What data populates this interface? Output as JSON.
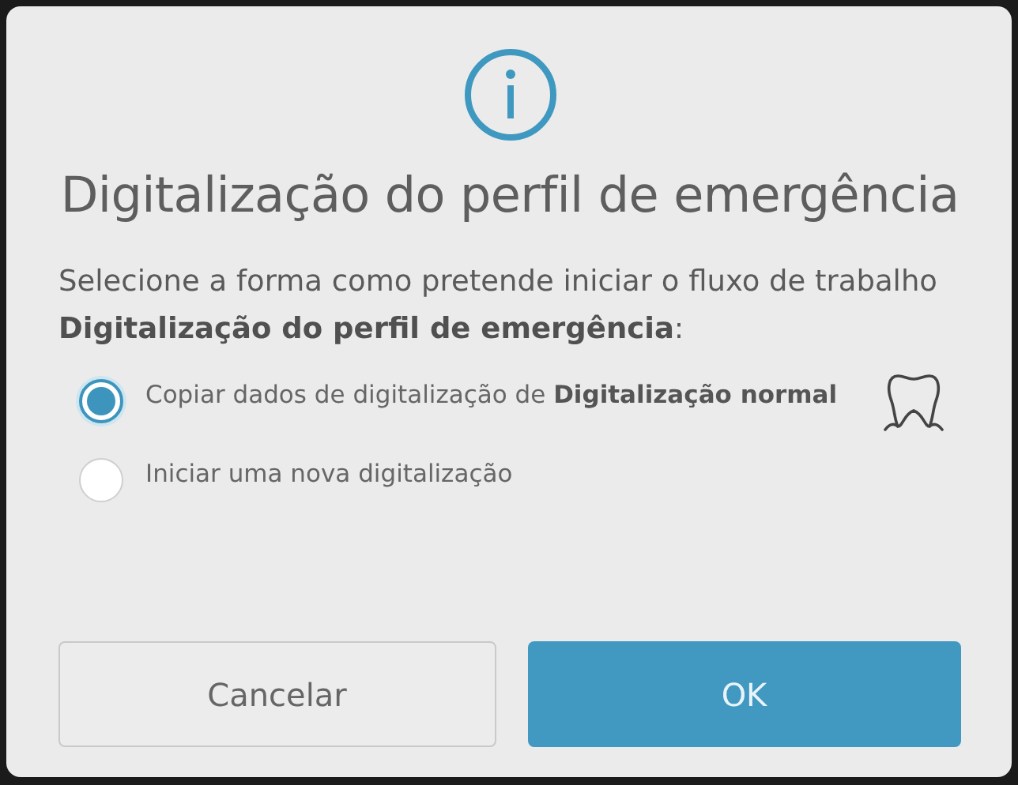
{
  "dialog": {
    "title": "Digitalização do perfil de emergência",
    "message": "Selecione a forma como pretende iniciar o fluxo de trabalho **Digitalização do perfil de emergência**:",
    "options": [
      {
        "kind": "copy",
        "label": "Copiar dados de digitalização de **Digitalização normal**",
        "selected": true
      },
      {
        "kind": "new",
        "label": "Iniciar uma nova digitalização",
        "selected": false
      }
    ],
    "buttons": [
      {
        "kind": "secondary",
        "label": "Cancelar"
      },
      {
        "kind": "primary",
        "label": "OK"
      }
    ]
  }
}
